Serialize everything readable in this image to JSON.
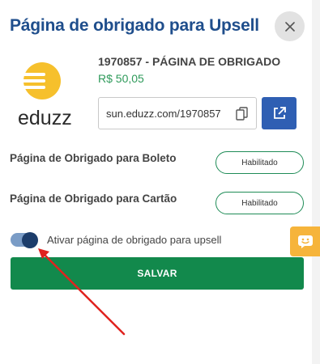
{
  "header": {
    "title": "Página de obrigado para Upsell"
  },
  "product": {
    "name": "1970857 - PÁGINA DE OBRIGADO",
    "price": "R$ 50,05",
    "logo_text": "eduzz",
    "url": "sun.eduzz.com/1970857"
  },
  "rows": [
    {
      "label": "Página de Obrigado para Boleto",
      "status": "Habilitado"
    },
    {
      "label": "Página de Obrigado para Cartão",
      "status": "Habilitado"
    }
  ],
  "toggle": {
    "label": "Ativar página de obrigado para upsell",
    "checked": true
  },
  "save_label": "SALVAR",
  "colors": {
    "title": "#1f4e8c",
    "price": "#2e9a5a",
    "primary_button": "#12894c",
    "open_button": "#2f5fb3",
    "chat_widget": "#f6b43b",
    "logo_yellow": "#f6c02c",
    "annotation_arrow": "#e0231f"
  },
  "icons": {
    "close": "close-icon",
    "copy": "copy-icon",
    "open": "external-link-icon",
    "chat": "chat-icon"
  }
}
